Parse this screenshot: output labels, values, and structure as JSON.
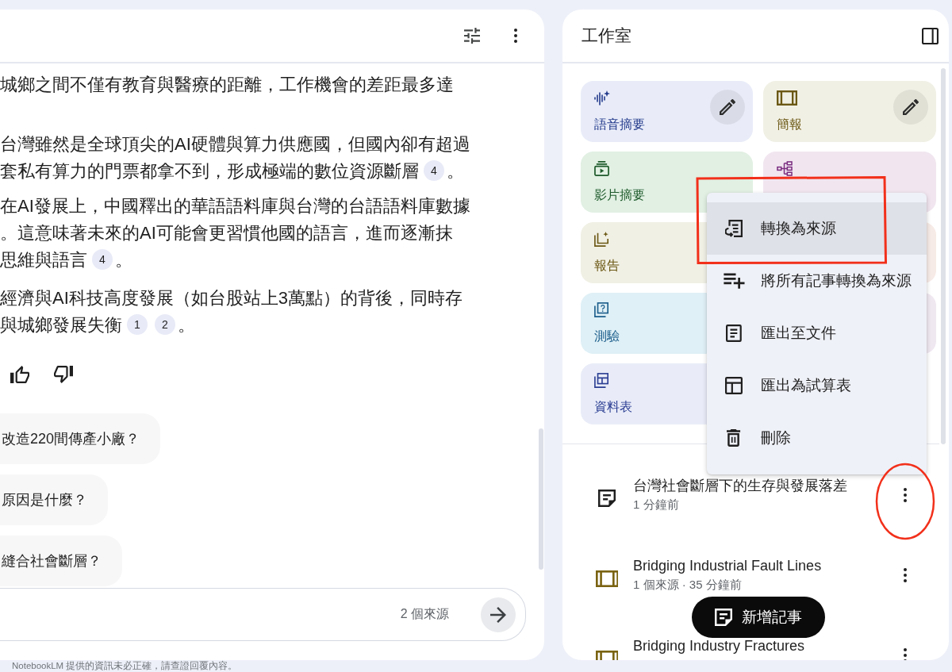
{
  "chat": {
    "paragraphs": [
      {
        "lines": [
          {
            "parts": [
              {
                "kind": "text",
                "text": "城鄉之間不僅有教育與醫療的距離，工作機會的差距最多達"
              }
            ]
          }
        ]
      },
      {
        "lines": [
          {
            "parts": [
              {
                "kind": "text",
                "text": "台灣雖然是全球頂尖的AI硬體與算力供應國，但國內卻有超過"
              }
            ]
          },
          {
            "parts": [
              {
                "kind": "text",
                "text": "套私有算力的門票都拿不到，形成極端的數位資源斷層"
              },
              {
                "kind": "cite",
                "text": "4"
              },
              {
                "kind": "text",
                "text": "。"
              }
            ]
          }
        ]
      },
      {
        "lines": [
          {
            "parts": [
              {
                "kind": "text",
                "text": "在AI發展上，中國釋出的華語語料庫與台灣的台語語料庫數據"
              }
            ]
          },
          {
            "parts": [
              {
                "kind": "text",
                "text": "。這意味著未來的AI可能會更習慣他國的語言，進而逐漸抹"
              }
            ]
          },
          {
            "parts": [
              {
                "kind": "text",
                "text": "思維與語言"
              },
              {
                "kind": "cite",
                "text": "4"
              },
              {
                "kind": "text",
                "text": "。"
              }
            ]
          }
        ]
      },
      {
        "lines": [
          {
            "parts": [
              {
                "kind": "text",
                "text": "經濟與AI科技高度發展（如台股站上3萬點）的背後，同時存"
              }
            ]
          },
          {
            "parts": [
              {
                "kind": "text",
                "text": "與城鄉發展失衡"
              },
              {
                "kind": "cite",
                "text": "1"
              },
              {
                "kind": "cite",
                "text": "2"
              },
              {
                "kind": "text",
                "text": "。"
              }
            ]
          }
        ]
      }
    ],
    "suggestions": [
      "改造220間傳產小廠？",
      "原因是什麼？",
      "縫合社會斷層？"
    ],
    "composer": {
      "source_count": "2 個來源"
    }
  },
  "studio": {
    "title": "工作室",
    "tiles": [
      {
        "kind": "audio",
        "label": "語音摘要",
        "color": "#e9ecf8",
        "edit_button": true
      },
      {
        "kind": "slides",
        "label": "簡報",
        "color": "#f1f0e5",
        "edit_button": true
      },
      {
        "kind": "video",
        "label": "影片摘要",
        "color": "#e1f0e3",
        "edit_button": false
      },
      {
        "kind": "mindmap",
        "color": "#f1e6f0",
        "edit_button": false
      },
      {
        "kind": "report",
        "label": "報告",
        "color": "#f1f0e5",
        "edit_button": false
      },
      {
        "color": "#f7ebe7"
      },
      {
        "kind": "quiz",
        "label": "測驗",
        "color": "#dff0f6",
        "edit_button": false
      },
      {
        "color": "#f0e8f1"
      },
      {
        "kind": "table",
        "label": "資料表",
        "color": "#e9ecf8",
        "edit_button": false
      }
    ],
    "menu": {
      "items": [
        {
          "kind": "convert",
          "label": "轉換為來源",
          "selected": true,
          "marked": true
        },
        {
          "kind": "batch",
          "label": "將所有記事轉換為來源",
          "selected": false,
          "marked": false
        },
        {
          "kind": "document",
          "label": "匯出至文件",
          "selected": false,
          "marked": false
        },
        {
          "kind": "spreadsheet",
          "label": "匯出為試算表",
          "selected": false,
          "marked": false
        },
        {
          "kind": "delete",
          "label": "刪除",
          "selected": false,
          "marked": false
        }
      ]
    },
    "notes": [
      {
        "kind": "note",
        "title": "台灣社會斷層下的生存與發展落差",
        "meta": "1 分鐘前",
        "circled": true
      },
      {
        "kind": "slides",
        "title": "Bridging Industrial Fault Lines",
        "meta": "1 個來源 · 35 分鐘前",
        "circled": false
      },
      {
        "kind": "slides",
        "title": "Bridging Industry Fractures",
        "circled": false
      }
    ],
    "add_note": "新增記事"
  },
  "disclaimer": "NotebookLM 提供的資訊未必正確，請查證回覆內容。"
}
